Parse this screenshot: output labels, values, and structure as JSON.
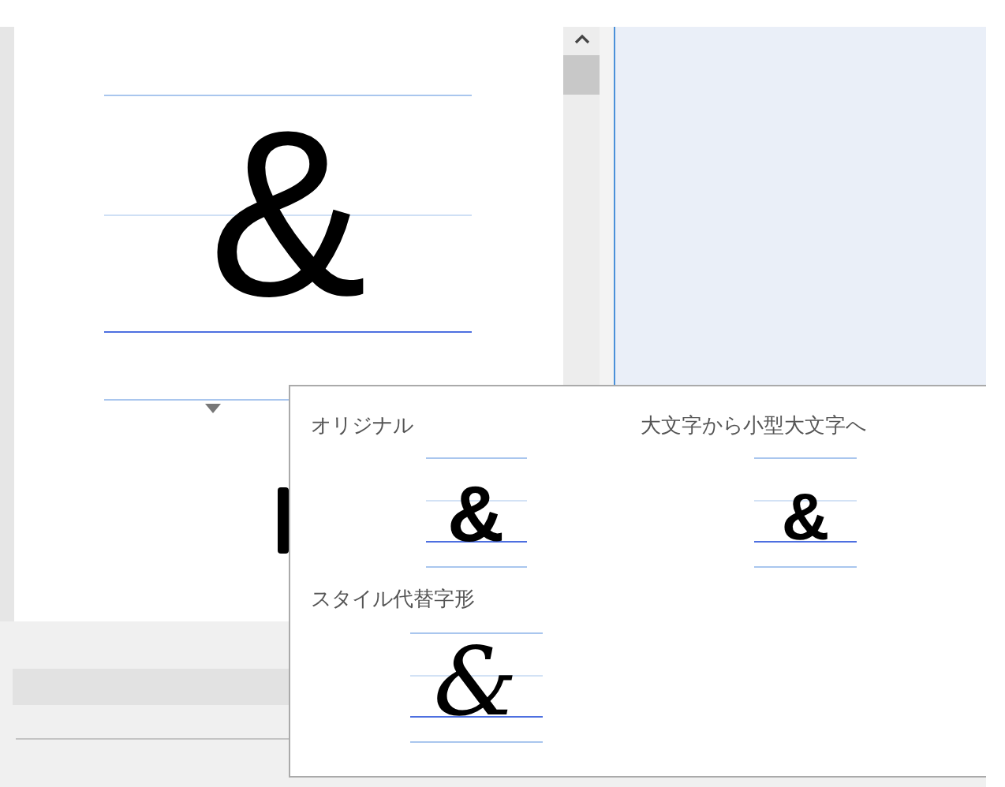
{
  "preview": {
    "glyph": "&"
  },
  "variants": [
    {
      "label": "オリジナル",
      "glyph": "&",
      "kind": "standard"
    },
    {
      "label": "大文字から小型大文字へ",
      "glyph": "&",
      "kind": "small"
    },
    {
      "label": "スタイル代替字形",
      "glyph": "&",
      "kind": "alternate"
    }
  ]
}
